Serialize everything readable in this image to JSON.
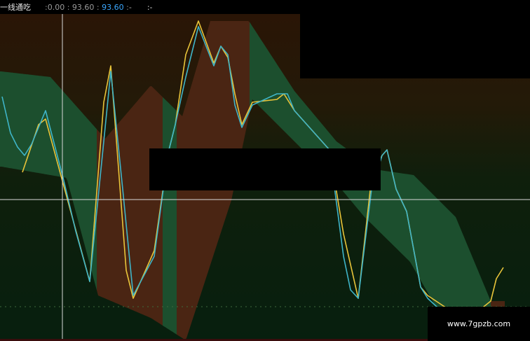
{
  "header": {
    "title": "一线通吃",
    "v1": "0.00",
    "v2": "93.60",
    "v3": "93.60",
    "v4": "-",
    "v5": "-"
  },
  "watermark": "www.7gpzb.com",
  "colors": {
    "background_top": "#2a1506",
    "background_bottom": "#071f0e",
    "band_green": "#1c4f2e",
    "band_brown": "#4a2513",
    "line_yellow": "#e8c43a",
    "line_cyan": "#3fb5c8",
    "crosshair": "#d9d9d9"
  },
  "chart_data": {
    "type": "line",
    "ylim": [
      0,
      100
    ],
    "grid": false,
    "band_upper": [
      [
        2,
        82
      ],
      [
        72,
        80
      ],
      [
        150,
        58
      ],
      [
        215,
        77
      ],
      [
        260,
        66
      ],
      [
        300,
        100
      ],
      [
        355,
        100
      ],
      [
        420,
        75
      ],
      [
        480,
        57
      ],
      [
        535,
        47
      ],
      [
        590,
        45
      ],
      [
        650,
        30
      ],
      [
        700,
        0
      ],
      [
        720,
        0
      ]
    ],
    "band_lower": [
      [
        2,
        48
      ],
      [
        95,
        44
      ],
      [
        140,
        2
      ],
      [
        215,
        -6
      ],
      [
        265,
        -14
      ],
      [
        330,
        36
      ],
      [
        360,
        72
      ],
      [
        480,
        42
      ],
      [
        520,
        30
      ],
      [
        585,
        14
      ],
      [
        640,
        -10
      ],
      [
        720,
        -10
      ]
    ],
    "band_colors": [
      {
        "from": 0,
        "to": 138,
        "color": "green"
      },
      {
        "from": 138,
        "to": 232,
        "color": "brown"
      },
      {
        "from": 232,
        "to": 252,
        "color": "green"
      },
      {
        "from": 252,
        "to": 356,
        "color": "brown"
      },
      {
        "from": 356,
        "to": 700,
        "color": "green"
      },
      {
        "from": 700,
        "to": 720,
        "color": "brown"
      }
    ],
    "series": [
      {
        "color": "yellow",
        "points": [
          [
            32,
            46
          ],
          [
            55,
            63
          ],
          [
            65,
            65
          ],
          [
            90,
            42
          ],
          [
            128,
            7
          ],
          [
            148,
            71
          ],
          [
            158,
            84
          ],
          [
            180,
            11
          ],
          [
            190,
            1
          ],
          [
            220,
            18
          ],
          [
            240,
            53
          ],
          [
            250,
            63
          ],
          [
            265,
            88
          ],
          [
            283,
            100
          ],
          [
            305,
            85
          ],
          [
            315,
            91
          ],
          [
            325,
            87
          ],
          [
            335,
            74
          ],
          [
            345,
            63
          ],
          [
            360,
            71
          ],
          [
            395,
            72
          ],
          [
            405,
            74
          ],
          [
            420,
            68
          ],
          [
            470,
            54
          ],
          [
            490,
            24
          ],
          [
            511,
            1
          ],
          [
            530,
            44
          ],
          [
            545,
            52
          ],
          [
            552,
            54
          ],
          [
            565,
            40
          ],
          [
            580,
            32
          ],
          [
            600,
            5
          ],
          [
            610,
            2
          ],
          [
            640,
            -3
          ],
          [
            680,
            -4
          ],
          [
            700,
            0
          ],
          [
            708,
            8
          ],
          [
            718,
            12
          ]
        ]
      },
      {
        "color": "cyan",
        "points": [
          [
            3,
            73
          ],
          [
            15,
            60
          ],
          [
            25,
            55
          ],
          [
            35,
            52
          ],
          [
            45,
            56
          ],
          [
            65,
            68
          ],
          [
            90,
            44
          ],
          [
            108,
            25
          ],
          [
            128,
            7
          ],
          [
            148,
            57
          ],
          [
            158,
            82
          ],
          [
            175,
            40
          ],
          [
            190,
            2
          ],
          [
            220,
            16
          ],
          [
            240,
            53
          ],
          [
            250,
            63
          ],
          [
            265,
            80
          ],
          [
            283,
            98
          ],
          [
            305,
            84
          ],
          [
            315,
            91
          ],
          [
            325,
            88
          ],
          [
            335,
            70
          ],
          [
            345,
            62
          ],
          [
            360,
            70
          ],
          [
            395,
            74
          ],
          [
            410,
            74
          ],
          [
            420,
            68
          ],
          [
            470,
            54
          ],
          [
            490,
            16
          ],
          [
            500,
            4
          ],
          [
            511,
            1
          ],
          [
            530,
            40
          ],
          [
            545,
            52
          ],
          [
            552,
            54
          ],
          [
            565,
            40
          ],
          [
            580,
            32
          ],
          [
            600,
            5
          ],
          [
            610,
            1
          ],
          [
            640,
            -6
          ],
          [
            700,
            -6
          ]
        ]
      }
    ]
  }
}
